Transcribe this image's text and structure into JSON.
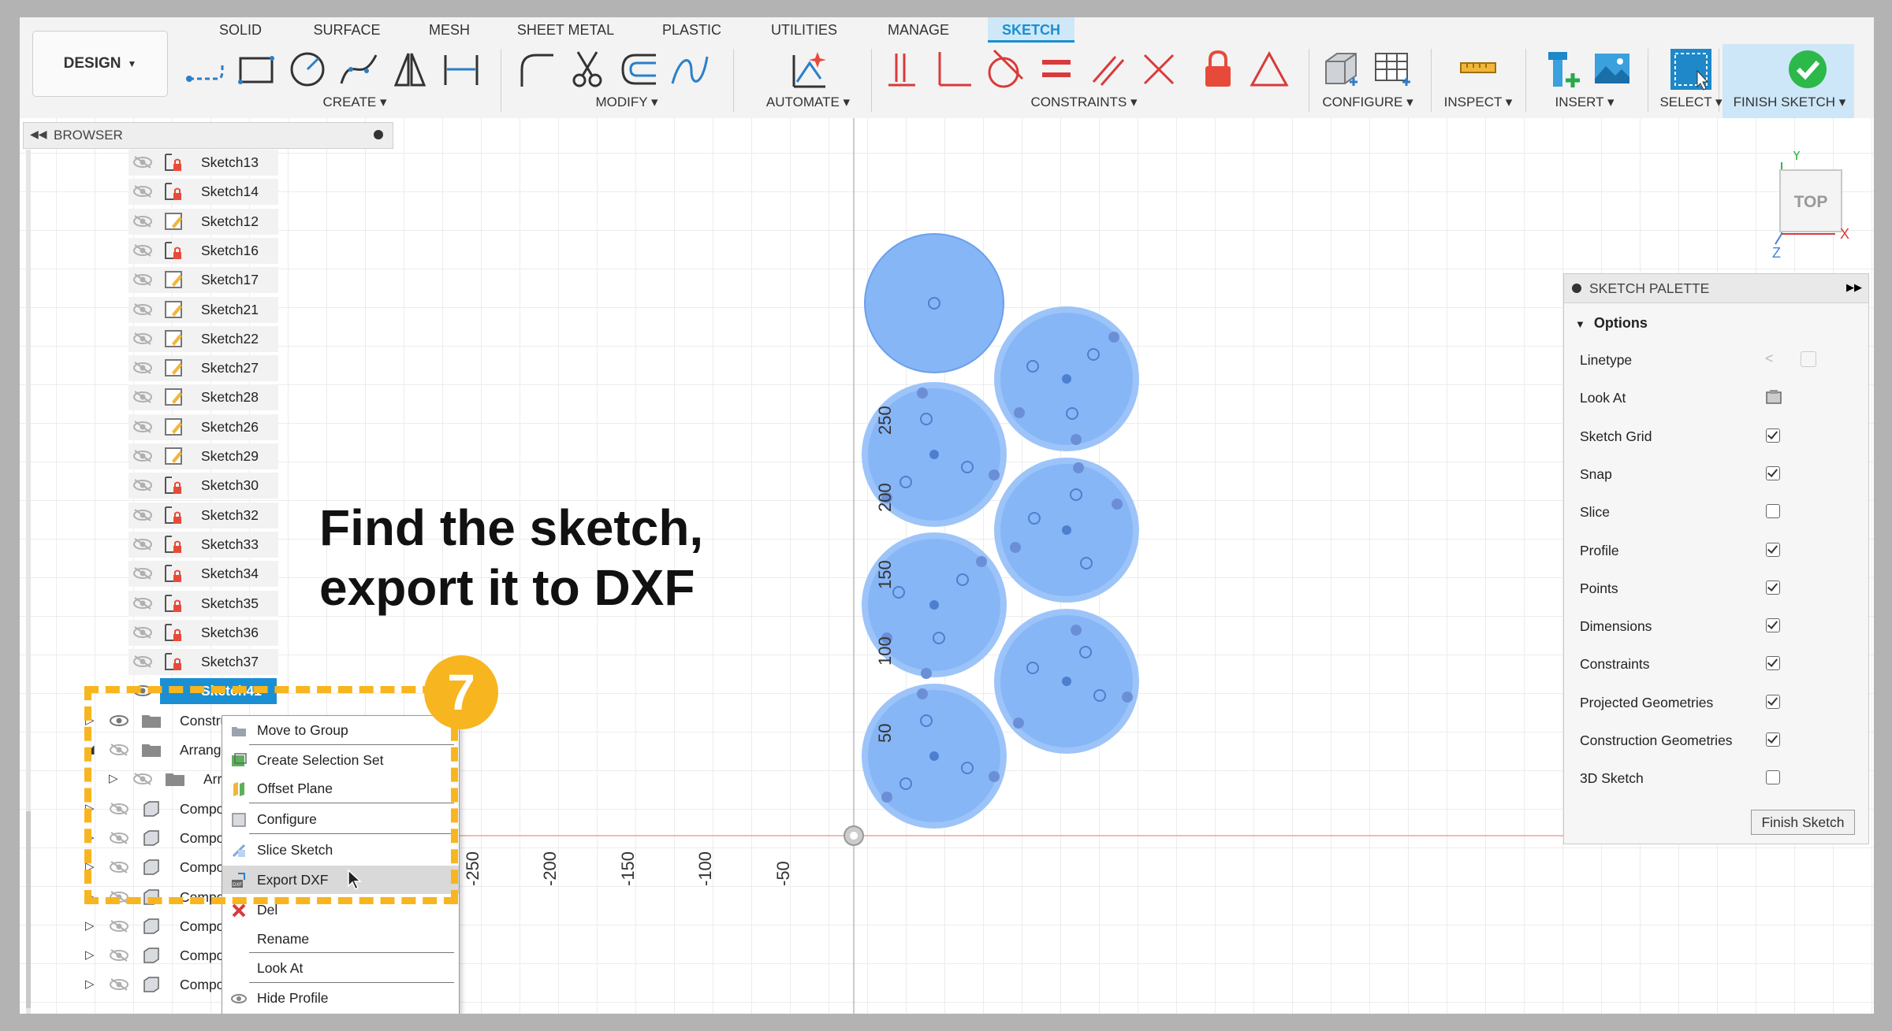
{
  "ribbon": {
    "workspace": "DESIGN",
    "tabs": [
      "SOLID",
      "SURFACE",
      "MESH",
      "SHEET METAL",
      "PLASTIC",
      "UTILITIES",
      "MANAGE",
      "SKETCH"
    ],
    "groups": [
      "CREATE",
      "MODIFY",
      "AUTOMATE",
      "CONSTRAINTS",
      "CONFIGURE",
      "INSPECT",
      "INSERT",
      "SELECT",
      "FINISH SKETCH"
    ],
    "accent": "#1a8fd3"
  },
  "browser": {
    "title": "BROWSER",
    "items": [
      {
        "label": "Sketch13"
      },
      {
        "label": "Sketch14"
      },
      {
        "label": "Sketch12"
      },
      {
        "label": "Sketch16"
      },
      {
        "label": "Sketch17"
      },
      {
        "label": "Sketch21"
      },
      {
        "label": "Sketch22"
      },
      {
        "label": "Sketch27"
      },
      {
        "label": "Sketch28"
      },
      {
        "label": "Sketch26"
      },
      {
        "label": "Sketch29"
      },
      {
        "label": "Sketch30"
      },
      {
        "label": "Sketch32"
      },
      {
        "label": "Sketch33"
      },
      {
        "label": "Sketch34"
      },
      {
        "label": "Sketch35"
      },
      {
        "label": "Sketch36"
      },
      {
        "label": "Sketch37"
      }
    ],
    "selected": "Sketch41",
    "folders": [
      "Construct",
      "Arrangen",
      "Arrang",
      "Compone",
      "Compone",
      "Compone",
      "Compone",
      "Compone",
      "Compone",
      "Compone"
    ]
  },
  "context_menu": {
    "items": [
      "Move to Group",
      "Create Selection Set",
      "Offset Plane",
      "Configure",
      "Slice Sketch",
      "Export DXF",
      "Del",
      "Rename",
      "Look At",
      "Hide Profile"
    ],
    "highlighted": "Export DXF"
  },
  "annotation": {
    "step": "7",
    "headline_line1": "Find the sketch,",
    "headline_line2": "export it to DXF",
    "color": "#f7b520"
  },
  "axis": {
    "x_ticks": [
      "-250",
      "-200",
      "-150",
      "-100",
      "-50"
    ],
    "y_ticks": [
      "250",
      "200",
      "150",
      "100",
      "50"
    ]
  },
  "viewcube": {
    "face": "TOP",
    "x": "X",
    "y": "Y",
    "z": "Z"
  },
  "palette": {
    "title": "SKETCH PALETTE",
    "section": "Options",
    "options": [
      {
        "label": "Linetype",
        "kind": "icons"
      },
      {
        "label": "Look At",
        "kind": "icon"
      },
      {
        "label": "Sketch Grid",
        "checked": true
      },
      {
        "label": "Snap",
        "checked": true
      },
      {
        "label": "Slice",
        "checked": false
      },
      {
        "label": "Profile",
        "checked": true
      },
      {
        "label": "Points",
        "checked": true
      },
      {
        "label": "Dimensions",
        "checked": true
      },
      {
        "label": "Constraints",
        "checked": true
      },
      {
        "label": "Projected Geometries",
        "checked": true
      },
      {
        "label": "Construction Geometries",
        "checked": true
      },
      {
        "label": "3D Sketch",
        "checked": false
      }
    ],
    "finish_label": "Finish Sketch"
  }
}
